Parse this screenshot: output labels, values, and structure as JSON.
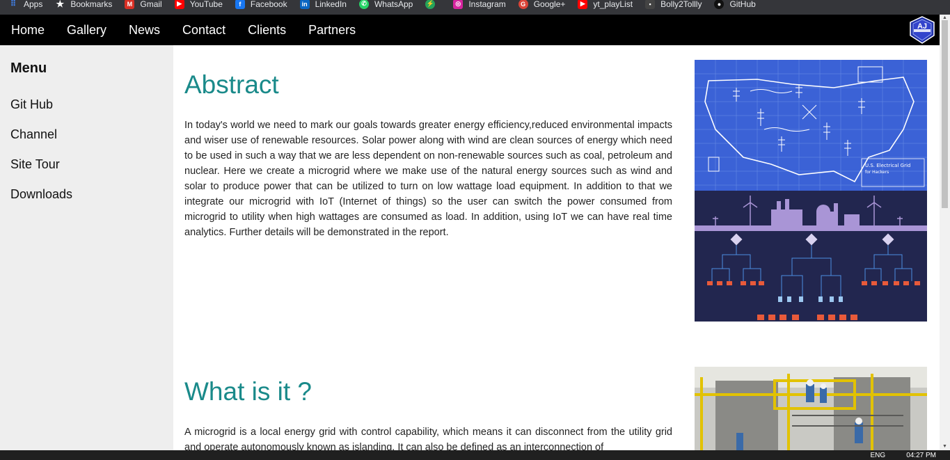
{
  "bookmarks": [
    {
      "label": "Apps",
      "icon": "apps-grid-icon",
      "color": "#4285f4"
    },
    {
      "label": "Bookmarks",
      "icon": "star-icon",
      "color": "#35363a"
    },
    {
      "label": "Gmail",
      "icon": "gmail-icon",
      "color": "#d93025"
    },
    {
      "label": "YouTube",
      "icon": "youtube-icon",
      "color": "#ff0000"
    },
    {
      "label": "Facebook",
      "icon": "facebook-icon",
      "color": "#1877f2"
    },
    {
      "label": "LinkedIn",
      "icon": "linkedin-icon",
      "color": "#0a66c2"
    },
    {
      "label": "WhatsApp",
      "icon": "whatsapp-icon",
      "color": "#25d366"
    },
    {
      "label": "",
      "icon": "bolt-icon",
      "color": "#25a35a"
    },
    {
      "label": "Instagram",
      "icon": "instagram-icon",
      "color": "#d6249f"
    },
    {
      "label": "Google+",
      "icon": "google-plus-icon",
      "color": "#db4437"
    },
    {
      "label": "yt_playList",
      "icon": "youtube-icon",
      "color": "#ff0000"
    },
    {
      "label": "Bolly2Tollly",
      "icon": "film-icon",
      "color": "#444"
    },
    {
      "label": "GitHub",
      "icon": "github-icon",
      "color": "#222"
    }
  ],
  "nav": {
    "items": [
      "Home",
      "Gallery",
      "News",
      "Contact",
      "Clients",
      "Partners"
    ],
    "logo_text": "AJ"
  },
  "sidebar": {
    "title": "Menu",
    "items": [
      "Git Hub",
      "Channel",
      "Site Tour",
      "Downloads"
    ]
  },
  "sections": [
    {
      "heading": "Abstract",
      "body": "In today's world we need to mark our goals towards greater energy efficiency,reduced environmental impacts and wiser use of renewable resources. Solar power along with wind are clean sources of energy which need to be used in such a way that we are less dependent on non-renewable sources such as coal, petroleum and nuclear. Here we create a microgrid where we make use of the natural energy sources such as wind and solar to produce power that can be utilized to turn on low wattage load equipment. In addition to that we integrate our microgrid with IoT (Internet of things) so the user can switch the power consumed from microgrid to utility when high wattages are consumed as load. In addition, using IoT we can have real time analytics. Further details will be demonstrated in the report."
    },
    {
      "heading": "What is it ?",
      "body": "A microgrid is a local energy grid with control capability, which means it can disconnect from the utility grid and operate autonomously known as islanding. It can also be defined as an interconnection of"
    }
  ],
  "blueprint": {
    "label": "U.S. Electrical Grid",
    "sublabel": "for Hackers"
  },
  "taskbar": {
    "lang": "ENG",
    "time": "04:27 PM"
  },
  "colors": {
    "heading": "#1a8a8a",
    "nav_bg": "#000000",
    "sidebar_bg": "#eeeeee"
  }
}
